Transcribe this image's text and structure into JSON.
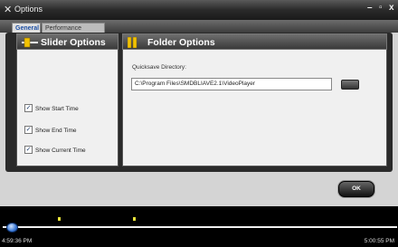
{
  "window": {
    "title": "Options",
    "minimize_label": "–",
    "maximize_label": "▫",
    "close_label": "x"
  },
  "tabs": [
    {
      "label": "General",
      "active": true
    },
    {
      "label": "Performance Settings",
      "active": false
    }
  ],
  "slider_options": {
    "title": "Slider Options",
    "items": [
      {
        "label": "Show Start Time",
        "checked": true
      },
      {
        "label": "Show End Time",
        "checked": true
      },
      {
        "label": "Show Current Time",
        "checked": true
      }
    ]
  },
  "folder_options": {
    "title": "Folder Options",
    "quicksave_label": "Quicksave Directory:",
    "quicksave_path": "C:\\Program Files\\SMDBLIAVE2.1\\VideoPlayer"
  },
  "ok_label": "OK",
  "timeline": {
    "start_time": "4:59:36 PM",
    "end_time": "5:00:55 PM",
    "progress": 0.02,
    "markers": [
      0.14,
      0.33
    ]
  },
  "colors": {
    "accent": "#1d4fa3",
    "marker": "#e8e23a",
    "thumb": "#3a78d6"
  }
}
